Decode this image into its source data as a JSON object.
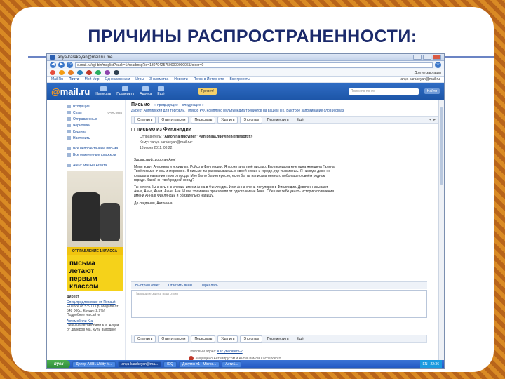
{
  "slide": {
    "title": "ПРИЧИНЫ РАСПРОСТРАНЕННОСТИ:"
  },
  "browser": {
    "tab_title": "anya-karakeyan@mail.ru: me..",
    "url": "e.mail.ru/cgi-bin/msglist?back=1#readmsg?id=13079425750000000006&folder=0",
    "bookmarks_right": "Другие закладки"
  },
  "topnav": {
    "items": [
      "Mail.Ru",
      "Почта",
      "Мой Мир",
      "Одноклассники",
      "Игры",
      "Знакомства",
      "Новости",
      "Поиск в Интернете",
      "Все проекты"
    ],
    "user": "anya-karakeyan@mail.ru"
  },
  "mail_header": {
    "logo_at": "@",
    "logo_text": "mail.ru",
    "tools": [
      "Написать",
      "Проверить",
      "Адреса",
      "Ещё"
    ],
    "write_button": "Привет!",
    "search_placeholder": "Поиск по почте",
    "find_button": "Найти"
  },
  "sidebar": {
    "folders": [
      {
        "label": "Входящие",
        "aux": ""
      },
      {
        "label": "Спам",
        "aux": "очистить"
      },
      {
        "label": "Отправленные",
        "aux": ""
      },
      {
        "label": "Черновики",
        "aux": ""
      },
      {
        "label": "Корзина",
        "aux": ""
      },
      {
        "label": "Настроить",
        "aux": ""
      }
    ],
    "filters": [
      "Все непрочитанные письма",
      "Все отмеченные флажком"
    ],
    "agent": "Агент Mail.Ru Агента",
    "ad": {
      "band": "ОТПРАВЛЕНИЕ 1 КЛАССА",
      "text_line1": "письма летают",
      "text_line2": "первым классом"
    },
    "direct_title": "Директ",
    "direct_items": [
      {
        "link": "Спец.предложение от Renault",
        "desc": "Fluence от 539 000р, Megane от 548 000р. Кредит 2,9%! Подробнее на сайте"
      },
      {
        "link": "Автомобили Kia",
        "desc": "Цены на автомобили Kia. Акции от дилеров Kia. Купи выгодно!"
      }
    ]
  },
  "message": {
    "heading": "Письмо",
    "prev": "« предыдущее",
    "next": "следующее »",
    "direct_line": "Директ  Английский для торговли. Пленэр РФ. Комплекс мультимедиа тренингов на вашем ПК. Быстрое запоминание слов и фраз",
    "toolbar": [
      "Ответить",
      "Ответить всем",
      "Переслать",
      "Удалить",
      "Это спам",
      "Переместить",
      "Ещё"
    ],
    "subject": "письмо из Финляндии",
    "from_label": "Отправитель:",
    "from": "\"Antonina Huovinen\" <antonina.huovinen@netsoft.fi>",
    "to_label": "Кому:",
    "to": "<anya-karakeyan@mail.ru>",
    "date": "13 июня 2011, 08:22",
    "body": [
      "Здравствуй, дорогая Аня!",
      "Меня зовут Антонина и я живу в г. Ройсо в Финляндии. Я прочитала твоё письмо. Его передала мне одна женщина Галина. Твоё письмо очень интересное. В письме ты рассказываешь о своей семье и городе, где ты живешь. Я никогда даже не слышала названия твоего города. Мне было бы интересно, если бы ты написала немного побольше о своём родном городе. Какой он твой родной город?",
      "Ты хотела бы знать о значении имени Анна в Финляндии. Имя Анна очень популярно в Финляндии. Девочек называют Анна, Аньа, Анни, Анне, Ани. И все эти имена произошли от одного имени Анна. Обещаю тебе узнать историю появления имени Анна в Финляндии и обязательно напишу.",
      "До свидания, Антонина"
    ],
    "reply_links": [
      "Быстрый ответ",
      "Ответить всем",
      "Переслать"
    ],
    "reply_placeholder": "Напишите здесь ваш ответ",
    "footer_line1": "Почтовый адрес:",
    "footer_link1": "Как увеличить?",
    "footer_line2": "Защищено Антивирусом и АнтиСпамом Касперского"
  },
  "taskbar": {
    "start": "пуск",
    "tasks": [
      "Дилер ABBL Utility M...",
      "anya-karakeyan@ma...",
      "ICQ",
      "Документ1 - Micros...",
      "Анти1..."
    ],
    "lang": "EN",
    "time": "22:36"
  }
}
